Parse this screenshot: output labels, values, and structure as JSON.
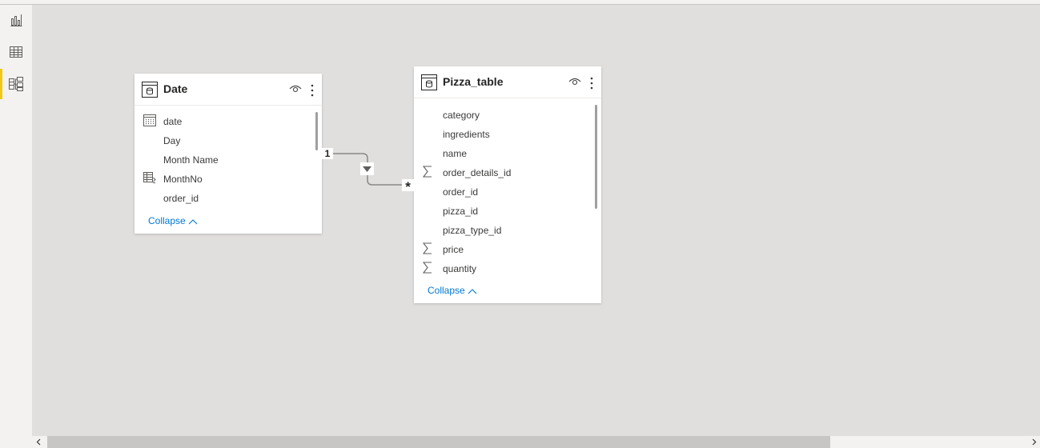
{
  "nav": {
    "items": [
      {
        "name": "report-view",
        "icon": "bar-chart-icon"
      },
      {
        "name": "data-view",
        "icon": "table-grid-icon"
      },
      {
        "name": "model-view",
        "icon": "model-diagram-icon",
        "active": true
      }
    ]
  },
  "tables": {
    "date": {
      "title": "Date",
      "fields": [
        {
          "label": "date",
          "icon": "calendar-icon"
        },
        {
          "label": "Day",
          "icon": ""
        },
        {
          "label": "Month Name",
          "icon": ""
        },
        {
          "label": "MonthNo",
          "icon": "calculated-column-icon"
        },
        {
          "label": "order_id",
          "icon": ""
        }
      ],
      "collapse_label": "Collapse"
    },
    "pizza": {
      "title": "Pizza_table",
      "fields": [
        {
          "label": "category",
          "icon": ""
        },
        {
          "label": "ingredients",
          "icon": ""
        },
        {
          "label": "name",
          "icon": ""
        },
        {
          "label": "order_details_id",
          "icon": "sigma-icon"
        },
        {
          "label": "order_id",
          "icon": ""
        },
        {
          "label": "pizza_id",
          "icon": ""
        },
        {
          "label": "pizza_type_id",
          "icon": ""
        },
        {
          "label": "price",
          "icon": "sigma-icon"
        },
        {
          "label": "quantity",
          "icon": "sigma-icon"
        }
      ],
      "collapse_label": "Collapse"
    }
  },
  "relationship": {
    "from_cardinality": "1",
    "to_cardinality": "*",
    "filter_direction": "single"
  },
  "colors": {
    "accent": "#f2c811",
    "link": "#0078d4",
    "canvas": "#e1dfdd"
  }
}
